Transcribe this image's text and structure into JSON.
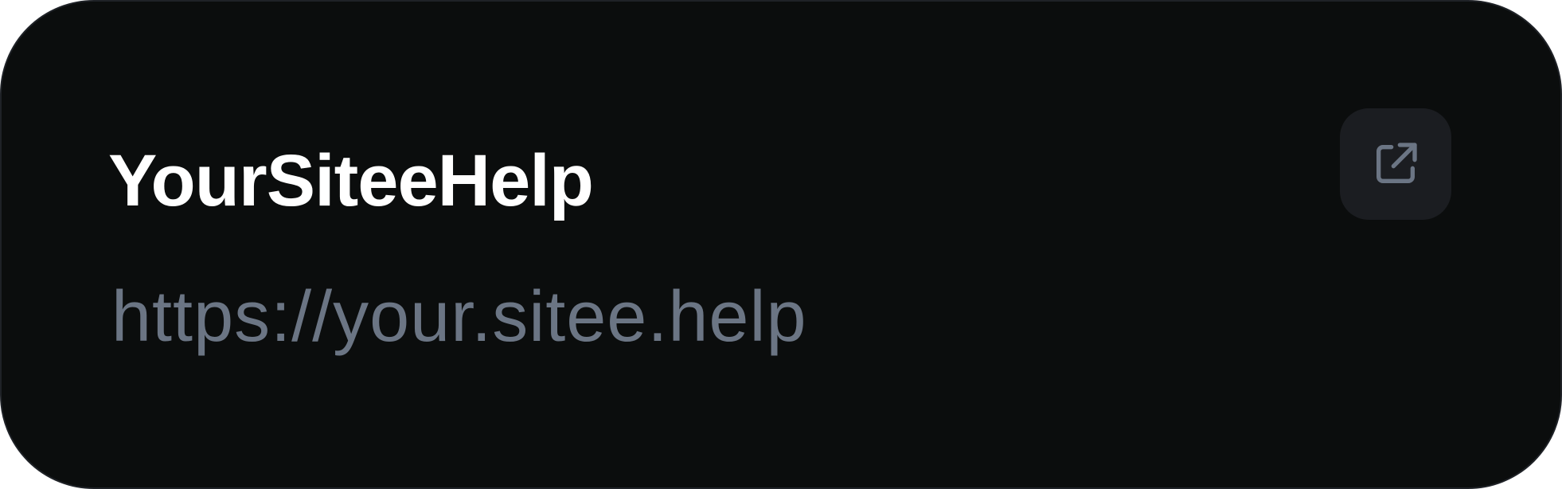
{
  "card": {
    "title": "YourSiteeHelp",
    "url": "https://your.sitee.help",
    "open_button_icon": "external-link-icon"
  },
  "colors": {
    "card_background": "#0b0d0d",
    "card_border": "#1f2227",
    "title_text": "#ffffff",
    "url_text": "#6b7584",
    "button_background": "#1b1d21",
    "icon_stroke": "#6b7584"
  }
}
